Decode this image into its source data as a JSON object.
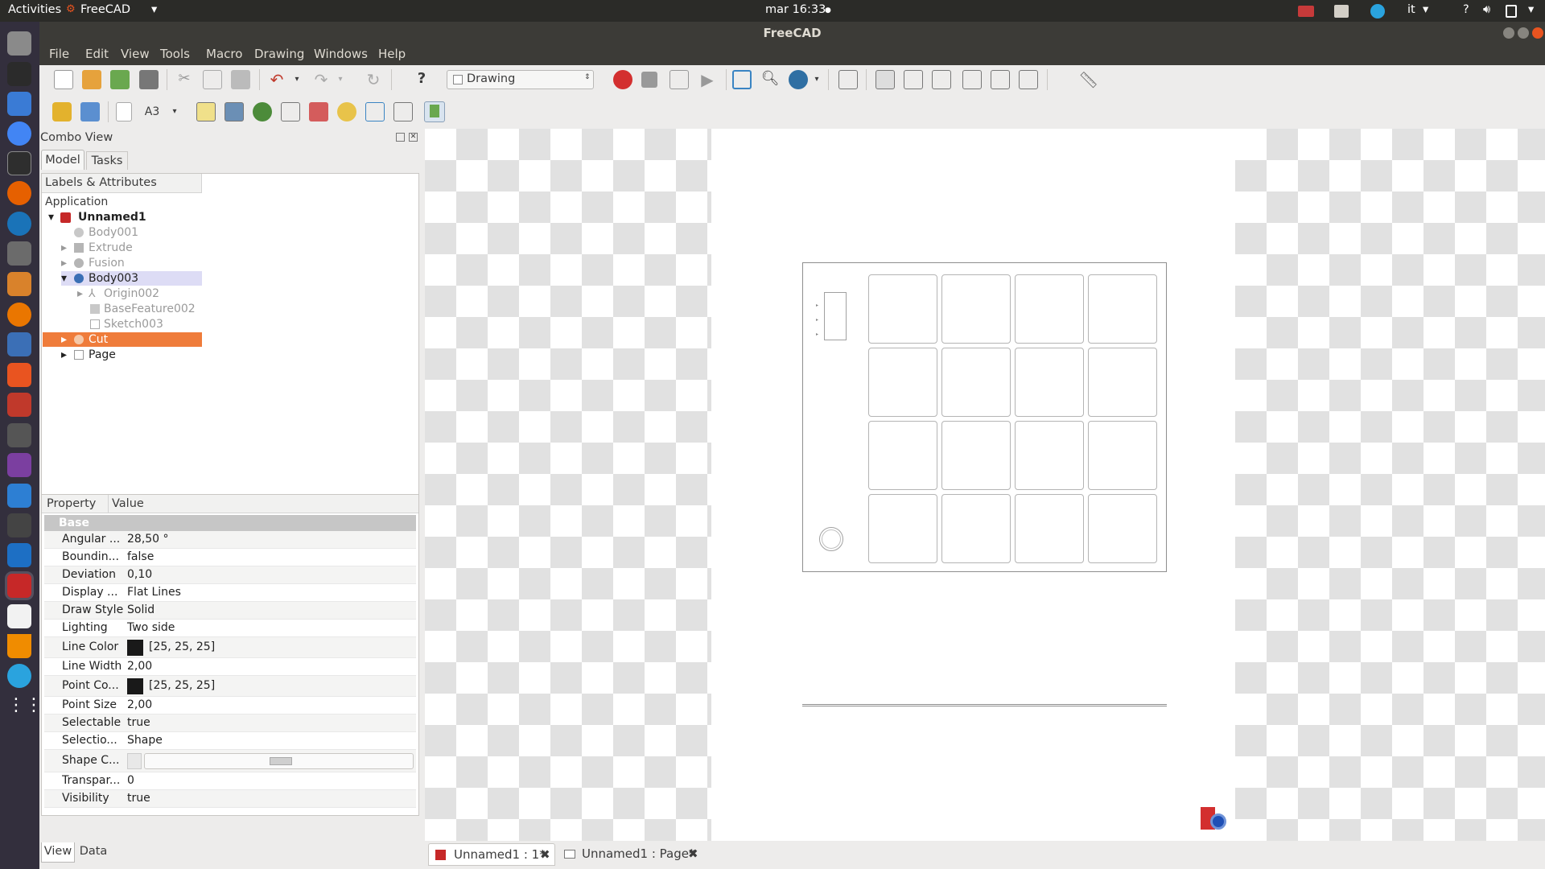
{
  "topbar": {
    "activities": "Activities",
    "app": "FreeCAD",
    "clock": "mar 16:33",
    "lang": "it",
    "help": "?"
  },
  "window": {
    "title": "FreeCAD"
  },
  "menu": [
    "File",
    "Edit",
    "View",
    "Tools",
    "Macro",
    "Drawing",
    "Windows",
    "Help"
  ],
  "toolbar": {
    "workbench": "Drawing"
  },
  "combo": {
    "title": "Combo View",
    "tabs": [
      "Model",
      "Tasks"
    ],
    "tree_header": "Labels & Attributes",
    "application": "Application",
    "tree": [
      {
        "label": "Unnamed1",
        "icon": "document-icon"
      },
      {
        "label": "Body001",
        "icon": "body-icon"
      },
      {
        "label": "Extrude",
        "icon": "extrude-icon"
      },
      {
        "label": "Fusion",
        "icon": "fusion-icon"
      },
      {
        "label": "Body003",
        "icon": "body-icon"
      },
      {
        "label": "Origin002",
        "icon": "origin-icon"
      },
      {
        "label": "BaseFeature002",
        "icon": "feature-icon"
      },
      {
        "label": "Sketch003",
        "icon": "sketch-icon"
      },
      {
        "label": "Cut",
        "icon": "cut-icon"
      },
      {
        "label": "Page",
        "icon": "page-icon"
      }
    ]
  },
  "properties": {
    "headers": [
      "Property",
      "Value"
    ],
    "group": "Base",
    "rows": [
      {
        "name": "Angular ...",
        "value": "28,50 °"
      },
      {
        "name": "Boundin...",
        "value": "false"
      },
      {
        "name": "Deviation",
        "value": "0,10"
      },
      {
        "name": "Display ...",
        "value": "Flat Lines"
      },
      {
        "name": "Draw Style",
        "value": "Solid"
      },
      {
        "name": "Lighting",
        "value": "Two side"
      },
      {
        "name": "Line Color",
        "value": "[25, 25, 25]"
      },
      {
        "name": "Line Width",
        "value": "2,00"
      },
      {
        "name": "Point Co...",
        "value": "[25, 25, 25]"
      },
      {
        "name": "Point Size",
        "value": "2,00"
      },
      {
        "name": "Selectable",
        "value": "true"
      },
      {
        "name": "Selectio...",
        "value": "Shape"
      },
      {
        "name": "Shape C...",
        "value": ""
      },
      {
        "name": "Transpar...",
        "value": "0"
      },
      {
        "name": "Visibility",
        "value": "true"
      }
    ],
    "bottom_tabs": [
      "View",
      "Data"
    ]
  },
  "doc_tabs": [
    "Unnamed1 : 1*",
    "Unnamed1 : Page*"
  ],
  "colors": {
    "selection": "#ef7c3b",
    "accent": "#e95420",
    "dock": "#332f3d"
  }
}
